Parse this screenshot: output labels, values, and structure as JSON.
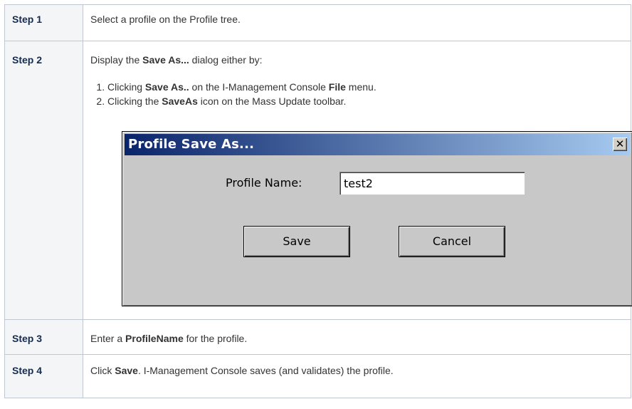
{
  "steps": [
    {
      "label": "Step 1",
      "text": "Select a profile on the Profile tree."
    },
    {
      "label": "Step 2",
      "intro_pre": "Display the ",
      "intro_bold": "Save As...",
      "intro_post": " dialog either by:",
      "items": [
        {
          "pre": "Clicking ",
          "bold1": "Save As..",
          "mid": " on the I-Management Console ",
          "bold2": "File",
          "post": " menu."
        },
        {
          "pre": "Clicking the ",
          "bold1": "SaveAs",
          "mid": " icon on the Mass Update toolbar.",
          "bold2": "",
          "post": ""
        }
      ]
    },
    {
      "label": "Step 3",
      "pre": "Enter a ",
      "bold": "ProfileName",
      "post": " for the profile."
    },
    {
      "label": "Step 4",
      "pre": "Click ",
      "bold": "Save",
      "post": ". I-Management Console saves (and validates) the profile."
    }
  ],
  "dialog": {
    "title": "Profile Save As...",
    "close_glyph": "✕",
    "field_label": "Profile Name:",
    "field_value": "test2",
    "save_label": "Save",
    "cancel_label": "Cancel",
    "titlebar_color_start": "#0a246a",
    "titlebar_color_end": "#a6caf0"
  }
}
